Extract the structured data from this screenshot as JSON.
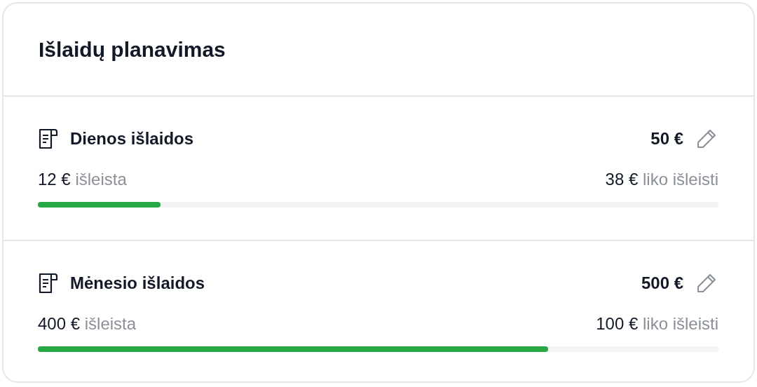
{
  "card": {
    "title": "Išlaidų planavimas"
  },
  "budgets": [
    {
      "name": "Dienos išlaidos",
      "limit": "50 €",
      "spent_amount": "12 €",
      "spent_label": "išleista",
      "left_amount": "38 €",
      "left_label": "liko išleisti",
      "level": 0.18
    },
    {
      "name": "Mėnesio išlaidos",
      "limit": "500 €",
      "spent_amount": "400 €",
      "spent_label": "išleista",
      "left_amount": "100 €",
      "left_label": "liko išleisti",
      "level": 0.75
    }
  ]
}
